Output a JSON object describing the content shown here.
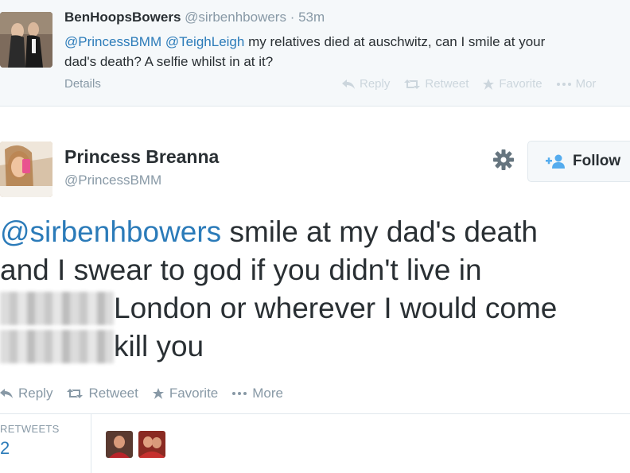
{
  "reply_tweet": {
    "author_name": "BenHoopsBowers",
    "author_handle": "@sirbenhbowers",
    "time": "· 53m",
    "mention_1": "@PrincessBMM",
    "mention_2": "@TeighLeigh",
    "text_line_1": " my relatives died at auschwitz, can I smile at your",
    "text_line_2": "dad's death? A selfie whilst in at it?",
    "details_label": "Details",
    "actions": {
      "reply": "Reply",
      "retweet": "Retweet",
      "favorite": "Favorite",
      "more": "Mor"
    }
  },
  "main_tweet": {
    "author_name": "Princess Breanna",
    "author_handle": "@PrincessBMM",
    "follow_label": "Follow",
    "mention": "@sirbenhbowers",
    "line_1_rest": " smile at my dad's death",
    "line_2": "and I swear to god if you didn't live in",
    "line_3_rest": "London or wherever I would come",
    "line_4_rest": "kill you",
    "actions": {
      "reply": "Reply",
      "retweet": "Retweet",
      "favorite": "Favorite",
      "more": "More"
    }
  },
  "stats": {
    "retweets_label": "RETWEETS",
    "retweets_count": "2"
  },
  "colors": {
    "link": "#2b7bb9",
    "muted": "#8899a6",
    "text": "#292f33",
    "background_top": "#f5f8fa"
  }
}
